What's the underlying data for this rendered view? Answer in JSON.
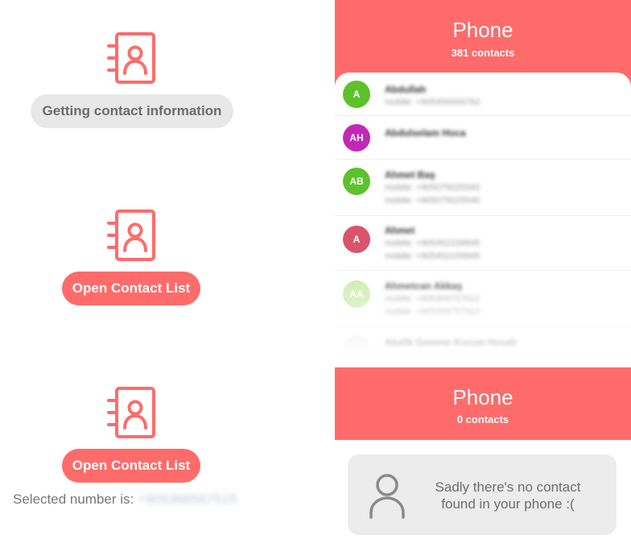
{
  "colors": {
    "accent": "#ff6b6b",
    "pill_grey": "#e8e8e8"
  },
  "left": {
    "loading_label": "Getting contact information",
    "open_button_label": "Open Contact List",
    "open_button_label_2": "Open Contact List",
    "selected_label": "Selected number is:",
    "selected_value": "+905366567515",
    "icon": "contact-book-icon"
  },
  "phone_list": {
    "title": "Phone",
    "subtitle": "381 contacts",
    "contacts": [
      {
        "initials": "A",
        "color": "#5cc22a",
        "name": "Abdullah",
        "numbers": [
          "mobile: +905450009762"
        ]
      },
      {
        "initials": "AH",
        "color": "#c228b5",
        "name": "Abdulselam Hoca",
        "numbers": []
      },
      {
        "initials": "AB",
        "color": "#5cc22a",
        "name": "Ahmet Baş",
        "numbers": [
          "mobile: +905075025540",
          "mobile: +905075025540"
        ]
      },
      {
        "initials": "A",
        "color": "#d9546b",
        "name": "Ahmet",
        "numbers": [
          "mobile: +905452159945",
          "mobile: +905452159945"
        ]
      },
      {
        "initials": "AA",
        "color": "#c8e8a4",
        "name": "Ahmetcan Akkaş",
        "numbers": [
          "mobile: +905309757610",
          "mobile: +905309757610"
        ]
      },
      {
        "initials": "",
        "color": "#eeeeee",
        "name": "Akelik Gemme Kurum Hesab",
        "numbers": []
      }
    ]
  },
  "phone_empty": {
    "title": "Phone",
    "subtitle": "0 contacts",
    "message": "Sadly there's no contact found in your phone :(",
    "icon": "person-icon"
  }
}
